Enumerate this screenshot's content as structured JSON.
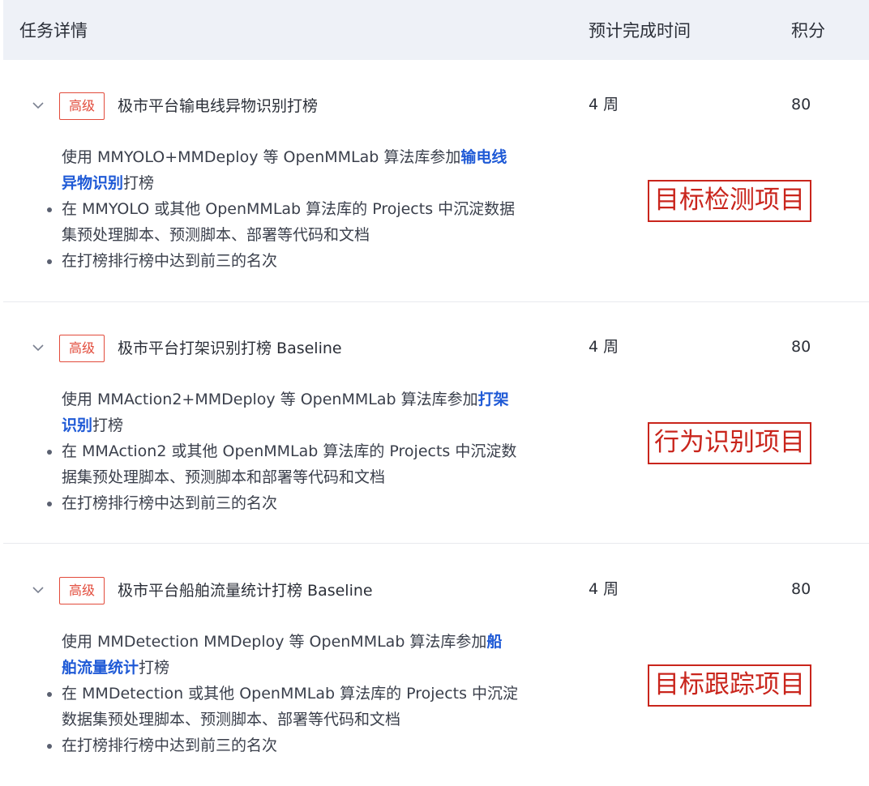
{
  "header": {
    "task_detail": "任务详情",
    "expected_time": "预计完成时间",
    "score": "积分"
  },
  "tasks": [
    {
      "badge": "高级",
      "title": "极市平台输电线异物识别打榜",
      "time": "4 周",
      "score": "80",
      "desc_prefix": "使用 MMYOLO+MMDeploy 等 OpenMMLab 算法库参加",
      "desc_highlight_1": "输电线",
      "desc_highlight_2": "异物识别",
      "desc_suffix": "打榜",
      "bullet_1a": "在 MMYOLO 或其他 OpenMMLab 算法库的 Projects 中沉淀数据",
      "bullet_1b": "集预处理脚本、预测脚本、部署等代码和文档",
      "bullet_2": "在打榜排行榜中达到前三的名次",
      "stamp": "目标检测项目"
    },
    {
      "badge": "高级",
      "title": "极市平台打架识别打榜 Baseline",
      "time": "4 周",
      "score": "80",
      "desc_prefix": "使用 MMAction2+MMDeploy 等 OpenMMLab 算法库参加",
      "desc_highlight_1": "打架",
      "desc_highlight_2": "识别",
      "desc_suffix": "打榜",
      "bullet_1a": "在 MMAction2 或其他 OpenMMLab 算法库的 Projects 中沉淀数",
      "bullet_1b": "据集预处理脚本、预测脚本和部署等代码和文档",
      "bullet_2": "在打榜排行榜中达到前三的名次",
      "stamp": "行为识别项目"
    },
    {
      "badge": "高级",
      "title": "极市平台船舶流量统计打榜 Baseline",
      "time": "4 周",
      "score": "80",
      "desc_prefix": "使用 MMDetection MMDeploy 等 OpenMMLab 算法库参加",
      "desc_highlight_1": "船",
      "desc_highlight_2": "舶流量统计",
      "desc_suffix": "打榜",
      "bullet_1a": "在 MMDetection 或其他 OpenMMLab 算法库的 Projects 中沉淀",
      "bullet_1b": "数据集预处理脚本、预测脚本、部署等代码和文档",
      "bullet_2": "在打榜排行榜中达到前三的名次",
      "stamp": "目标跟踪项目"
    }
  ],
  "colors": {
    "badge": "#e24b3b",
    "highlight": "#1f5ad6",
    "stamp": "#c9251c",
    "header_bg": "#eef1f7"
  }
}
